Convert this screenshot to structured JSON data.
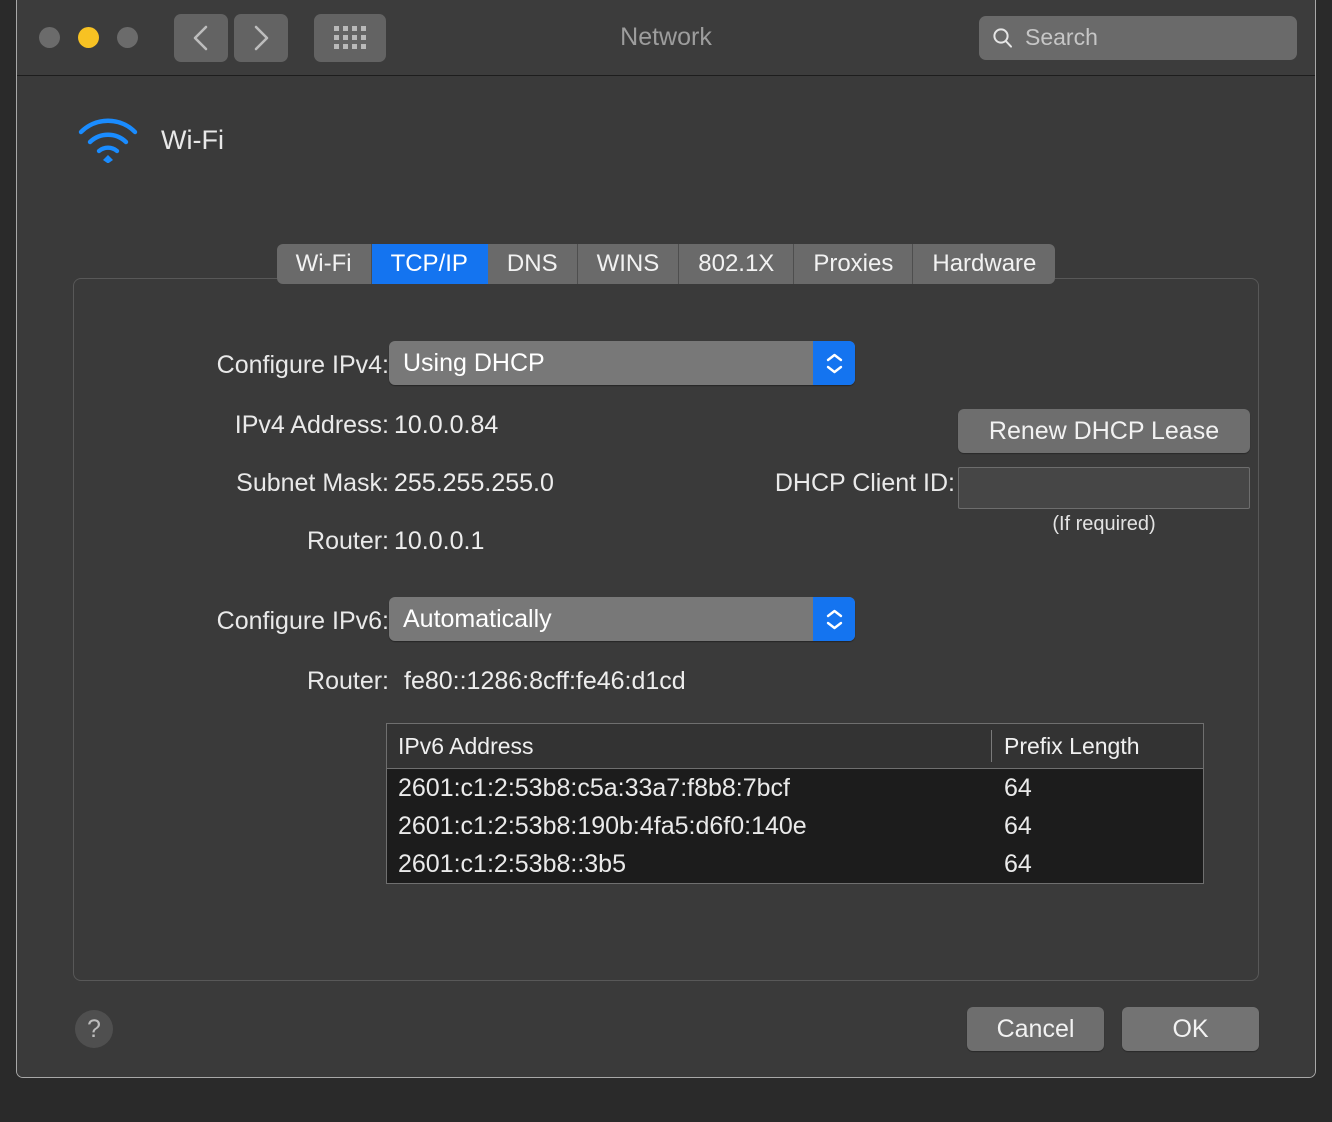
{
  "window": {
    "title": "Network",
    "traffic_lights": [
      "close-button",
      "minimize-button",
      "zoom-button"
    ],
    "nav": {
      "back": "back-icon",
      "forward": "forward-icon",
      "grid": "show-all-icon"
    },
    "search": {
      "placeholder": "Search",
      "value": "",
      "icon": "search-icon"
    }
  },
  "interface": {
    "icon": "wifi-icon",
    "name": "Wi-Fi"
  },
  "tabs": [
    {
      "label": "Wi-Fi",
      "active": false
    },
    {
      "label": "TCP/IP",
      "active": true
    },
    {
      "label": "DNS",
      "active": false
    },
    {
      "label": "WINS",
      "active": false
    },
    {
      "label": "802.1X",
      "active": false
    },
    {
      "label": "Proxies",
      "active": false
    },
    {
      "label": "Hardware",
      "active": false
    }
  ],
  "ipv4": {
    "configure_label": "Configure IPv4:",
    "configure_value": "Using DHCP",
    "address_label": "IPv4 Address:",
    "address_value": "10.0.0.84",
    "subnet_label": "Subnet Mask:",
    "subnet_value": "255.255.255.0",
    "router_label": "Router:",
    "router_value": "10.0.0.1",
    "renew_button": "Renew DHCP Lease",
    "client_id_label": "DHCP Client ID:",
    "client_id_value": "",
    "client_id_hint": "(If required)"
  },
  "ipv6": {
    "configure_label": "Configure IPv6:",
    "configure_value": "Automatically",
    "router_label": "Router:",
    "router_value": "fe80::1286:8cff:fe46:d1cd",
    "table": {
      "columns": [
        "IPv6 Address",
        "Prefix Length"
      ],
      "rows": [
        {
          "address": "2601:c1:2:53b8:c5a:33a7:f8b8:7bcf",
          "prefix": "64"
        },
        {
          "address": "2601:c1:2:53b8:190b:4fa5:d6f0:140e",
          "prefix": "64"
        },
        {
          "address": "2601:c1:2:53b8::3b5",
          "prefix": "64"
        }
      ]
    }
  },
  "footer": {
    "help": "?",
    "cancel": "Cancel",
    "ok": "OK"
  },
  "colors": {
    "accent": "#1474f0",
    "window_bg": "#3a3a3a",
    "titlebar_bg": "#3c3c3c",
    "control_gray": "#6e6e6e",
    "table_bg": "#1c1c1c",
    "wifi_icon": "#1a8cff",
    "yellow_light": "#f7c223"
  }
}
